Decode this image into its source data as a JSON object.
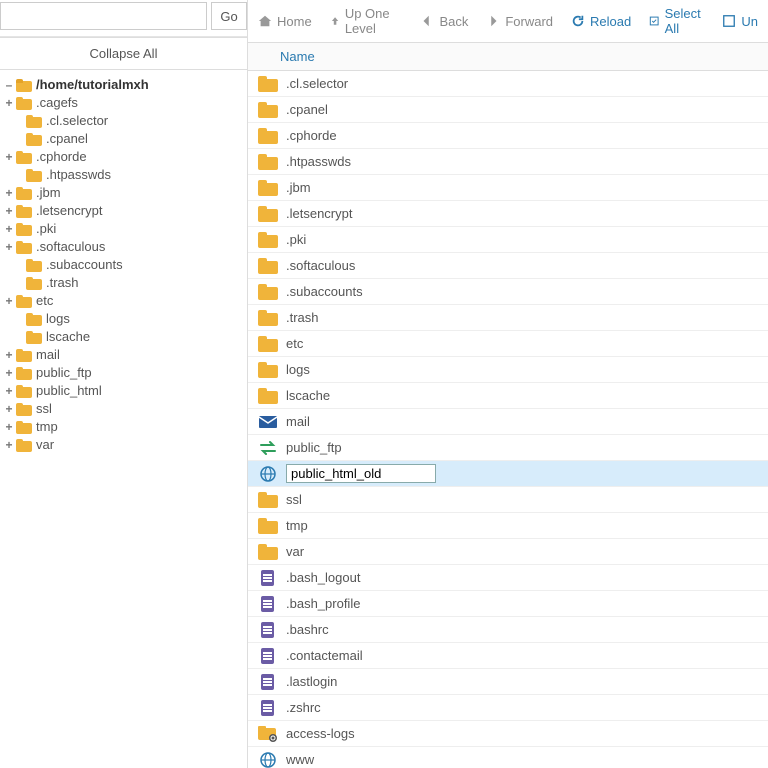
{
  "sidebar": {
    "go_label": "Go",
    "path_value": "",
    "collapse_label": "Collapse All",
    "root_label": "/home/tutorialmxh",
    "tree": [
      {
        "label": ".cagefs",
        "exp": "+",
        "indent": 1
      },
      {
        "label": ".cl.selector",
        "exp": "",
        "indent": 2
      },
      {
        "label": ".cpanel",
        "exp": "",
        "indent": 2
      },
      {
        "label": ".cphorde",
        "exp": "+",
        "indent": 1
      },
      {
        "label": ".htpasswds",
        "exp": "",
        "indent": 2
      },
      {
        "label": ".jbm",
        "exp": "+",
        "indent": 1
      },
      {
        "label": ".letsencrypt",
        "exp": "+",
        "indent": 1
      },
      {
        "label": ".pki",
        "exp": "+",
        "indent": 1
      },
      {
        "label": ".softaculous",
        "exp": "+",
        "indent": 1
      },
      {
        "label": ".subaccounts",
        "exp": "",
        "indent": 2
      },
      {
        "label": ".trash",
        "exp": "",
        "indent": 2
      },
      {
        "label": "etc",
        "exp": "+",
        "indent": 1
      },
      {
        "label": "logs",
        "exp": "",
        "indent": 2
      },
      {
        "label": "lscache",
        "exp": "",
        "indent": 2
      },
      {
        "label": "mail",
        "exp": "+",
        "indent": 1
      },
      {
        "label": "public_ftp",
        "exp": "+",
        "indent": 1
      },
      {
        "label": "public_html",
        "exp": "+",
        "indent": 1
      },
      {
        "label": "ssl",
        "exp": "+",
        "indent": 1
      },
      {
        "label": "tmp",
        "exp": "+",
        "indent": 1
      },
      {
        "label": "var",
        "exp": "+",
        "indent": 1
      }
    ]
  },
  "toolbar": {
    "home": "Home",
    "up": "Up One Level",
    "back": "Back",
    "forward": "Forward",
    "reload": "Reload",
    "select_all": "Select All",
    "unselect": "Un"
  },
  "header": {
    "name_col": "Name"
  },
  "rename_value": "public_html_old",
  "files": [
    {
      "name": ".cl.selector",
      "icon": "folder"
    },
    {
      "name": ".cpanel",
      "icon": "folder"
    },
    {
      "name": ".cphorde",
      "icon": "folder"
    },
    {
      "name": ".htpasswds",
      "icon": "folder"
    },
    {
      "name": ".jbm",
      "icon": "folder"
    },
    {
      "name": ".letsencrypt",
      "icon": "folder"
    },
    {
      "name": ".pki",
      "icon": "folder"
    },
    {
      "name": ".softaculous",
      "icon": "folder"
    },
    {
      "name": ".subaccounts",
      "icon": "folder"
    },
    {
      "name": ".trash",
      "icon": "folder"
    },
    {
      "name": "etc",
      "icon": "folder"
    },
    {
      "name": "logs",
      "icon": "folder"
    },
    {
      "name": "lscache",
      "icon": "folder"
    },
    {
      "name": "mail",
      "icon": "mail"
    },
    {
      "name": "public_ftp",
      "icon": "swap"
    },
    {
      "name": "public_html_old",
      "icon": "globe",
      "editing": true,
      "selected": true
    },
    {
      "name": "ssl",
      "icon": "folder"
    },
    {
      "name": "tmp",
      "icon": "folder"
    },
    {
      "name": "var",
      "icon": "folder"
    },
    {
      "name": ".bash_logout",
      "icon": "doc"
    },
    {
      "name": ".bash_profile",
      "icon": "doc"
    },
    {
      "name": ".bashrc",
      "icon": "doc"
    },
    {
      "name": ".contactemail",
      "icon": "doc"
    },
    {
      "name": ".lastlogin",
      "icon": "doc"
    },
    {
      "name": ".zshrc",
      "icon": "doc"
    },
    {
      "name": "access-logs",
      "icon": "link"
    },
    {
      "name": "www",
      "icon": "globe"
    }
  ]
}
